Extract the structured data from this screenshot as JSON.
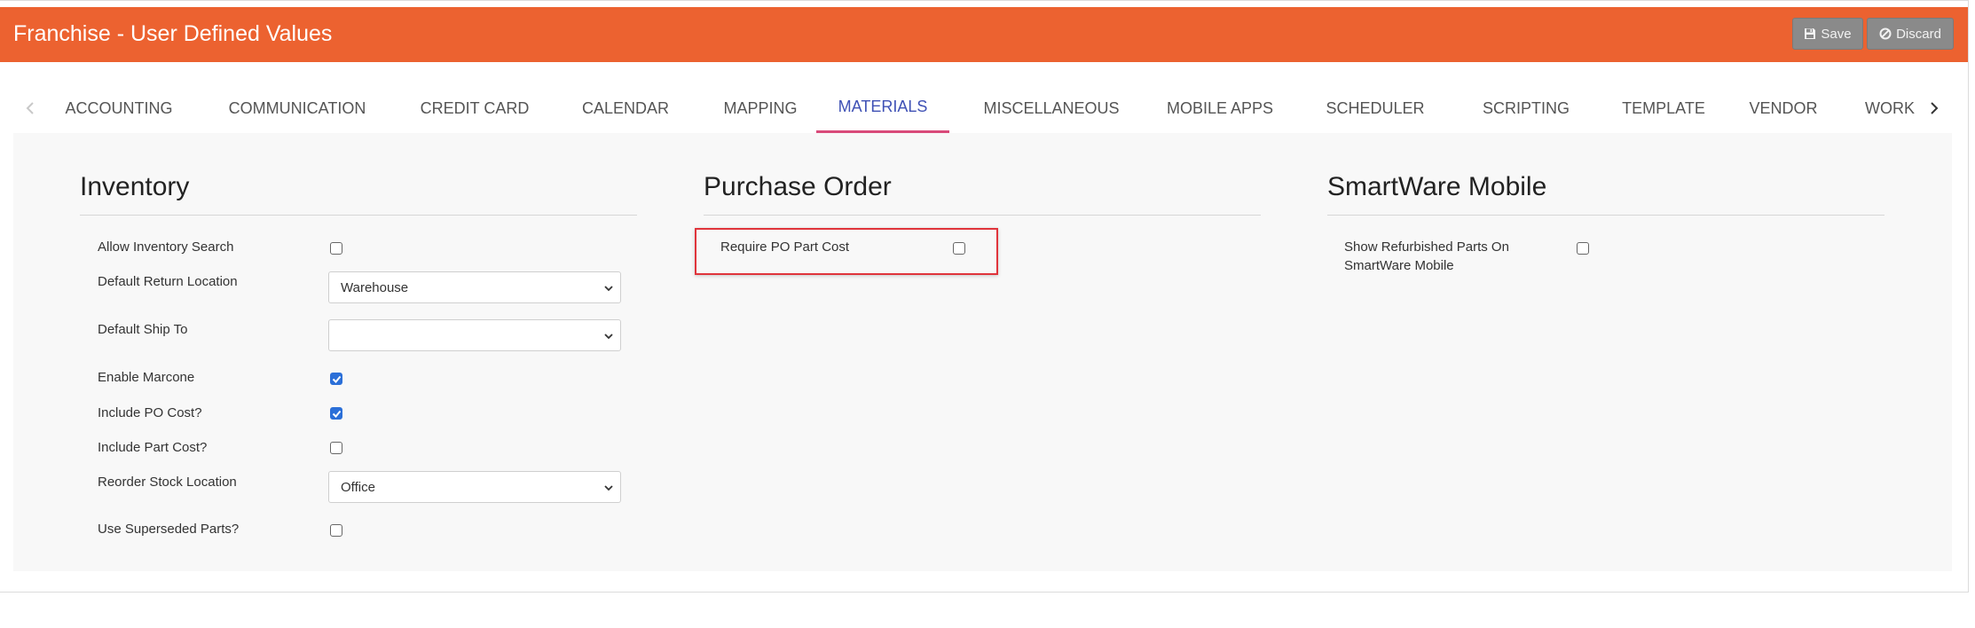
{
  "header": {
    "title": "Franchise - User Defined Values",
    "save_label": "Save",
    "discard_label": "Discard",
    "color": "#ec6230"
  },
  "tabs": [
    {
      "label": "ACCOUNTING"
    },
    {
      "label": "COMMUNICATION"
    },
    {
      "label": "CREDIT CARD"
    },
    {
      "label": "CALENDAR"
    },
    {
      "label": "MAPPING"
    },
    {
      "label": "MATERIALS",
      "active": true
    },
    {
      "label": "MISCELLANEOUS"
    },
    {
      "label": "MOBILE APPS"
    },
    {
      "label": "SCHEDULER"
    },
    {
      "label": "SCRIPTING"
    },
    {
      "label": "TEMPLATE"
    },
    {
      "label": "VENDOR"
    },
    {
      "label": "WORK"
    }
  ],
  "inventory": {
    "title": "Inventory",
    "allow_inventory_search": {
      "label": "Allow Inventory Search",
      "checked": false
    },
    "default_return_location": {
      "label": "Default Return Location",
      "value": "Warehouse"
    },
    "default_ship_to": {
      "label": "Default Ship To",
      "value": ""
    },
    "enable_marcone": {
      "label": "Enable Marcone",
      "checked": true
    },
    "include_po_cost": {
      "label": "Include PO Cost?",
      "checked": true
    },
    "include_part_cost": {
      "label": "Include Part Cost?",
      "checked": false
    },
    "reorder_stock_location": {
      "label": "Reorder Stock Location",
      "value": "Office"
    },
    "use_superseded_parts": {
      "label": "Use Superseded Parts?",
      "checked": false
    }
  },
  "purchase_order": {
    "title": "Purchase Order",
    "require_po_part_cost": {
      "label": "Require PO Part Cost",
      "checked": false
    }
  },
  "smartware_mobile": {
    "title": "SmartWare Mobile",
    "show_refurbished_line1": "Show Refurbished Parts On",
    "show_refurbished_line2": "SmartWare Mobile",
    "show_refurbished_checked": false
  },
  "colors": {
    "active_tab_text": "#3f51b5",
    "active_tab_underline": "#d94a7a",
    "checkbox_checked": "#2b6fd8",
    "highlight_border": "#e0343b"
  }
}
